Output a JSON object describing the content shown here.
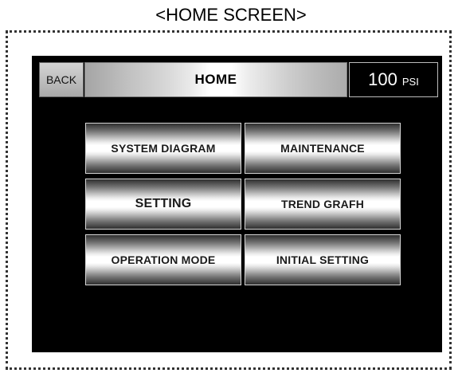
{
  "caption": "<HOME SCREEN>",
  "header": {
    "back_label": "BACK",
    "title": "HOME",
    "pressure_value": "100",
    "pressure_unit": "PSI"
  },
  "menu": {
    "system_diagram": "SYSTEM DIAGRAM",
    "maintenance": "MAINTENANCE",
    "setting": "SETTING",
    "trend_grafh": "TREND GRAFH",
    "operation_mode": "OPERATION MODE",
    "initial_setting": "INITIAL SETTING"
  }
}
